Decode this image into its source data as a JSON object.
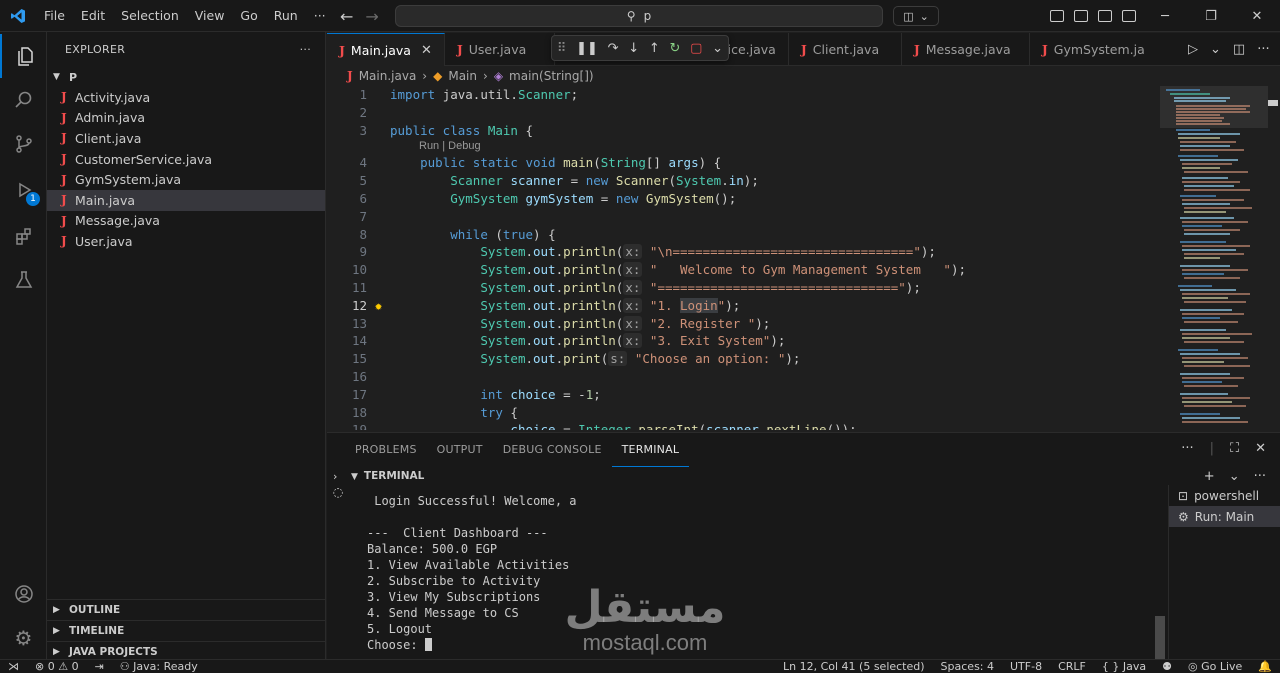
{
  "titlebar": {
    "menu": [
      "File",
      "Edit",
      "Selection",
      "View",
      "Go",
      "Run",
      "···"
    ],
    "search_text": "p"
  },
  "explorer": {
    "title": "EXPLORER",
    "more": "···",
    "folder": "P",
    "files": [
      "Activity.java",
      "Admin.java",
      "Client.java",
      "CustomerService.java",
      "GymSystem.java",
      "Main.java",
      "Message.java",
      "User.java"
    ],
    "active_file": "Main.java",
    "sections": [
      "OUTLINE",
      "TIMELINE",
      "JAVA PROJECTS"
    ]
  },
  "activity_badge": "1",
  "tabs": [
    {
      "label": "Main.java",
      "active": true
    },
    {
      "label": "User.java",
      "active": false
    },
    {
      "label": "merService.java",
      "active": false
    },
    {
      "label": "Client.java",
      "active": false
    },
    {
      "label": "Message.java",
      "active": false
    },
    {
      "label": "GymSystem.ja",
      "active": false
    }
  ],
  "breadcrumb": {
    "file": "Main.java",
    "class": "Main",
    "method": "main(String[])"
  },
  "codelens": "Run | Debug",
  "current_line": 12,
  "panel": {
    "tabs": [
      "PROBLEMS",
      "OUTPUT",
      "DEBUG CONSOLE",
      "TERMINAL"
    ],
    "active_tab": "TERMINAL",
    "terminal_header": "TERMINAL",
    "terminal_lines": [
      " Login Successful! Welcome, a",
      "",
      "---  Client Dashboard ---",
      "Balance: 500.0 EGP",
      "1. View Available Activities",
      "2. Subscribe to Activity",
      "3. View My Subscriptions",
      "4. Send Message to CS",
      "5. Logout",
      "Choose: "
    ],
    "terminals": [
      "powershell",
      "Run: Main"
    ],
    "active_terminal": "Run: Main"
  },
  "watermark": {
    "arabic": "مستقل",
    "latin": "mostaql.com"
  },
  "statusbar": {
    "errors": "0",
    "warnings": "0",
    "java": "Java: Ready",
    "position": "Ln 12, Col 41 (5 selected)",
    "spaces": "Spaces: 4",
    "encoding": "UTF-8",
    "eol": "CRLF",
    "language": "{ } Java",
    "golive": "Go Live"
  },
  "colors": {
    "accent": "#0078d4",
    "java_icon": "#f14c4c",
    "keyword": "#569cd6",
    "type": "#4ec9b0",
    "string": "#ce9178"
  }
}
